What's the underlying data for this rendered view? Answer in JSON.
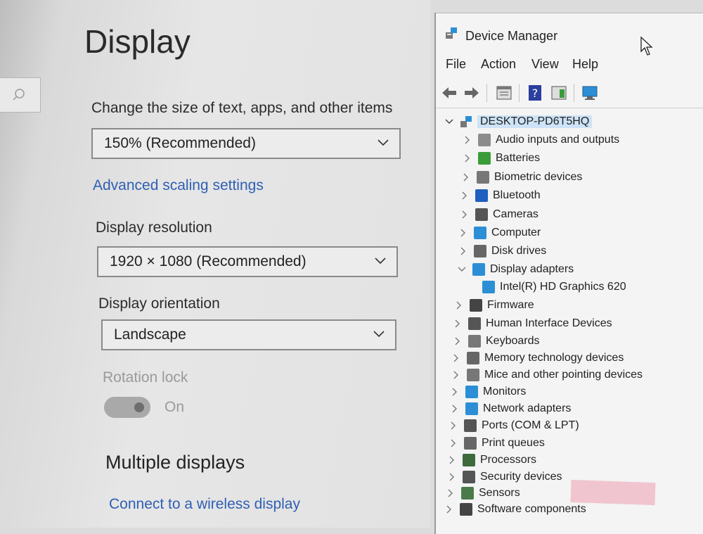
{
  "settings": {
    "title": "Display",
    "scale_label": "Change the size of text, apps, and other items",
    "scale_value": "150% (Recommended)",
    "advanced_link": "Advanced scaling settings",
    "resolution_label": "Display resolution",
    "resolution_value": "1920 × 1080 (Recommended)",
    "orientation_label": "Display orientation",
    "orientation_value": "Landscape",
    "rotation_lock_label": "Rotation lock",
    "rotation_lock_state": "On",
    "multiple_displays_title": "Multiple displays",
    "wireless_link": "Connect to a wireless display"
  },
  "device_manager": {
    "title": "Device Manager",
    "menu": [
      "File",
      "Action",
      "View",
      "Help"
    ],
    "root": "DESKTOP-PD6T5HQ",
    "items": [
      {
        "label": "Audio inputs and outputs",
        "icon": "speaker-icon",
        "color": "#8c8c8c"
      },
      {
        "label": "Batteries",
        "icon": "battery-icon",
        "color": "#3a9d3a"
      },
      {
        "label": "Biometric devices",
        "icon": "fingerprint-icon",
        "color": "#777777"
      },
      {
        "label": "Bluetooth",
        "icon": "bluetooth-icon",
        "color": "#1f5fbf"
      },
      {
        "label": "Cameras",
        "icon": "camera-icon",
        "color": "#555555"
      },
      {
        "label": "Computer",
        "icon": "monitor-icon",
        "color": "#2c8fd6"
      },
      {
        "label": "Disk drives",
        "icon": "disk-icon",
        "color": "#666666"
      },
      {
        "label": "Display adapters",
        "icon": "display-adapter-icon",
        "color": "#2c8fd6"
      },
      {
        "label": "Intel(R) HD Graphics 620",
        "icon": "display-adapter-icon",
        "color": "#2c8fd6"
      },
      {
        "label": "Firmware",
        "icon": "chip-icon",
        "color": "#444444"
      },
      {
        "label": "Human Interface Devices",
        "icon": "hid-icon",
        "color": "#555555"
      },
      {
        "label": "Keyboards",
        "icon": "keyboard-icon",
        "color": "#777777"
      },
      {
        "label": "Memory technology devices",
        "icon": "memory-icon",
        "color": "#666666"
      },
      {
        "label": "Mice and other pointing devices",
        "icon": "mouse-icon",
        "color": "#777777"
      },
      {
        "label": "Monitors",
        "icon": "monitor-icon",
        "color": "#2c8fd6"
      },
      {
        "label": "Network adapters",
        "icon": "network-icon",
        "color": "#2c8fd6"
      },
      {
        "label": "Ports (COM & LPT)",
        "icon": "port-icon",
        "color": "#555555"
      },
      {
        "label": "Print queues",
        "icon": "printer-icon",
        "color": "#666666"
      },
      {
        "label": "Processors",
        "icon": "processor-icon",
        "color": "#3d6b3d"
      },
      {
        "label": "Security devices",
        "icon": "security-icon",
        "color": "#555555"
      },
      {
        "label": "Sensors",
        "icon": "sensor-icon",
        "color": "#4a7a4a"
      },
      {
        "label": "Software components",
        "icon": "software-icon",
        "color": "#444444"
      }
    ]
  }
}
